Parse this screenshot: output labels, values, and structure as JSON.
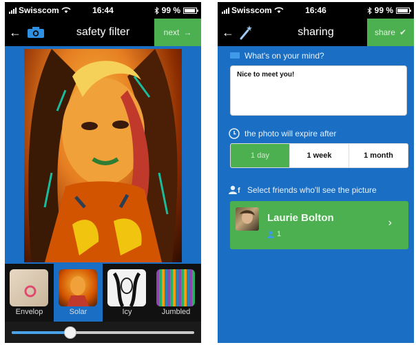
{
  "status_left": {
    "carrier": "Swisscom",
    "time": "16:44",
    "battery": "99 %"
  },
  "status_right": {
    "carrier": "Swisscom",
    "time": "16:46",
    "battery": "99 %"
  },
  "filter_screen": {
    "back_glyph": "←",
    "title": "safety filter",
    "next_label": "next",
    "next_glyph": "→",
    "filters": [
      {
        "label": "Envelop",
        "selected": false
      },
      {
        "label": "Solar",
        "selected": true
      },
      {
        "label": "Icy",
        "selected": false
      },
      {
        "label": "Jumbled",
        "selected": false
      }
    ],
    "slider_value": 0.32
  },
  "sharing_screen": {
    "back_glyph": "←",
    "title": "sharing",
    "share_label": "share",
    "share_glyph": "✔",
    "mind_prompt": "What's on your mind?",
    "message_text": "Nice to meet you!",
    "expire_label": "the photo will expire after",
    "expire_options": [
      {
        "label": "1 day",
        "active": true
      },
      {
        "label": "1 week",
        "active": false
      },
      {
        "label": "1 month",
        "active": false
      }
    ],
    "friends_label": "Select friends who'll see the picture",
    "friend": {
      "name": "Laurie Bolton",
      "count": "1",
      "chevron": "›"
    }
  },
  "colors": {
    "app_blue": "#1a6fc4",
    "green": "#4caf50",
    "bar_black": "#000000"
  }
}
